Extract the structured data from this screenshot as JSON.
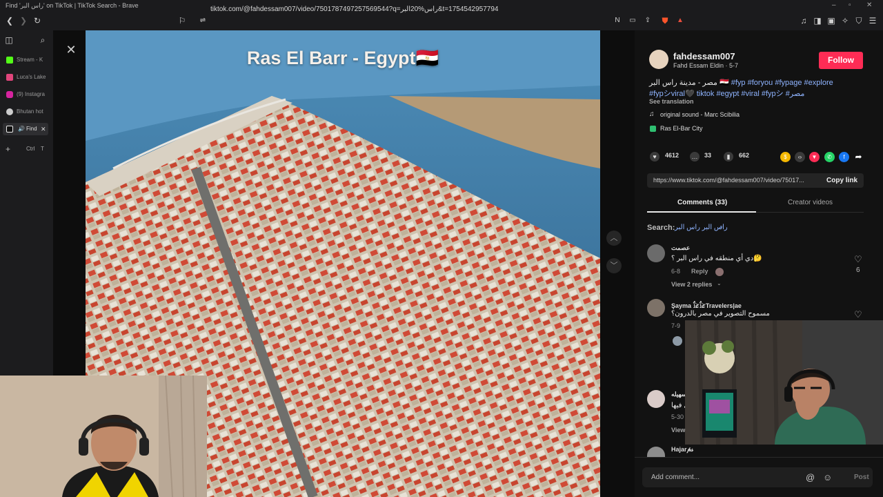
{
  "window": {
    "title": "Find 'راس البر' on TikTok | TikTok Search - Brave"
  },
  "addressbar": {
    "url": "tiktok.com/@fahdessam007/video/7501787497257569544?q=راس%20البر&t=1754542957794"
  },
  "sidebar": {
    "tabs": [
      {
        "label": "Stream - K",
        "color": "#53fc18"
      },
      {
        "label": "Luca's Lake",
        "color": "#e0457b"
      },
      {
        "label": "(9) Instagra",
        "color": "#d6249f"
      },
      {
        "label": "Bhutan hot",
        "color": "#cccccc"
      },
      {
        "label": "Find",
        "color": "#eeeeee"
      }
    ],
    "new_tab_shortcut_mod": "Ctrl",
    "new_tab_shortcut_key": "T"
  },
  "video": {
    "overlay_title": "Ras El Barr - Egypt🇪🇬"
  },
  "post": {
    "username": "fahdessam007",
    "display_name": "Fahd Essam Eldin · 5-7",
    "follow_label": "Follow",
    "caption_line1_text": "مصر - مدينة راس البر 🇪🇬 ",
    "caption_line1_tags": "#fyp #foryou #fypage #explore",
    "caption_line2_tags": "#fypシviral🖤 tiktok #egypt #viral #fypシ #مصر",
    "see_translation": "See translation",
    "sound": "original sound - Marc Scibilia",
    "location": "Ras El-Bar City",
    "likes": "4612",
    "comments": "33",
    "saves": "662",
    "link": "https://www.tiktok.com/@fahdessam007/video/75017...",
    "copy_link": "Copy link"
  },
  "tabs": {
    "comments": "Comments (33)",
    "creator_videos": "Creator videos"
  },
  "search": {
    "label": "Search:",
    "query": "راس البر راس البر"
  },
  "comments": [
    {
      "user": "عصمت",
      "text": "دي أي منطقه في راس البر ؟🤔",
      "date": "6-8",
      "reply": "Reply",
      "likes": "6",
      "view_replies": "View 2 replies"
    },
    {
      "user": "Şayma 𓃠𓃠Travelers|ae",
      "text": "مسموح التصوير في مصر بالدرون؟",
      "date": "7-9"
    },
    {
      "user": "سهيله",
      "text": "ل فيها",
      "date": "5-30",
      "view": "View"
    },
    {
      "user": "Hajar𝓅𝓈"
    }
  ],
  "comment_input": {
    "placeholder": "Add comment...",
    "post_label": "Post"
  }
}
